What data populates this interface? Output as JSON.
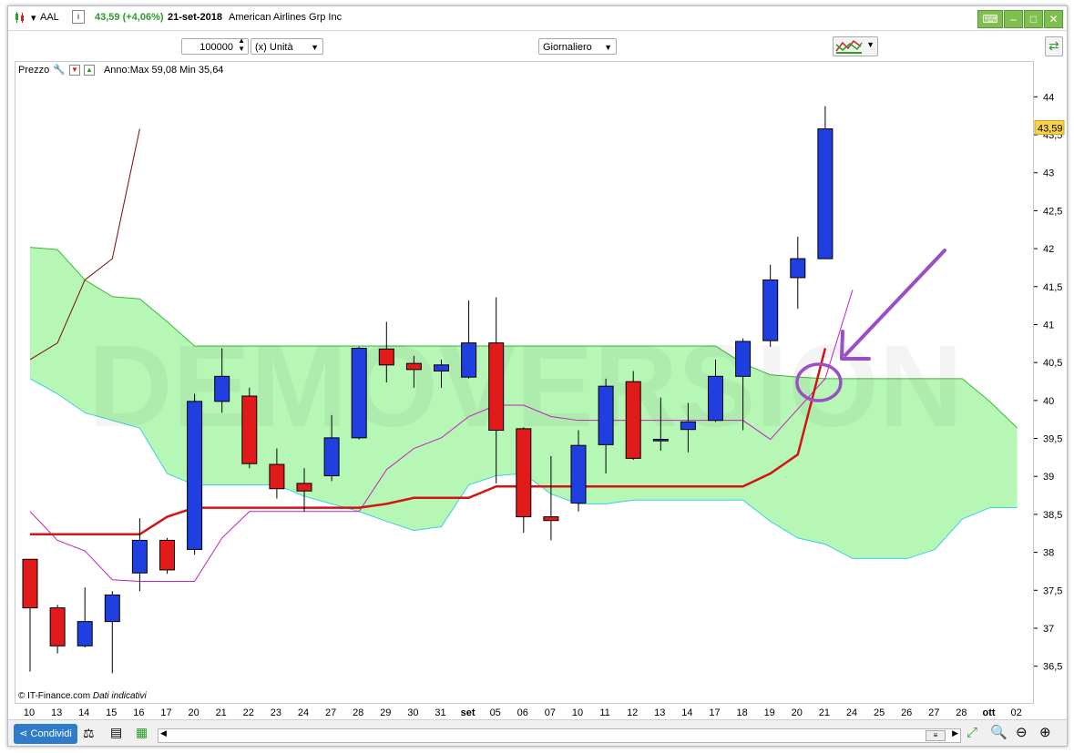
{
  "header": {
    "symbol": "AAL",
    "price_change": "43,59 (+4,06%)",
    "date": "21-set-2018",
    "company": "American Airlines Grp Inc"
  },
  "toolbar": {
    "quantity": "100000",
    "unit": "(x) Unità",
    "period": "Giornaliero"
  },
  "chart_panel": {
    "label": "Prezzo",
    "range_info": "Anno:Max 59,08 Min 35,64",
    "watermark": "DEMOVERSION",
    "copyright": "© IT-Finance.com",
    "disclaimer": "Dati indicativi",
    "last_price_label": "43,59"
  },
  "bottom": {
    "share_label": "Condividi"
  },
  "colors": {
    "bull": "#1f3fe0",
    "bear": "#e11a1a",
    "cloud": "#b6f7b6",
    "kijun": "#d21414",
    "tenkan": "#c020c0",
    "chikou": "#7a0a0a",
    "annotation": "#9a4fc4"
  },
  "chart_data": {
    "type": "candlestick",
    "y_range": [
      36.1,
      44.4
    ],
    "y_ticks": [
      "44",
      "43,5",
      "43",
      "42,5",
      "42",
      "41,5",
      "41",
      "40,5",
      "40",
      "39,5",
      "39",
      "38,5",
      "38",
      "37,5",
      "37",
      "36,5"
    ],
    "y_tick_values": [
      44,
      43.5,
      43,
      42.5,
      42,
      41.5,
      41,
      40.5,
      40,
      39.5,
      39,
      38.5,
      38,
      37.5,
      37,
      36.5
    ],
    "x_labels": [
      "10",
      "13",
      "14",
      "15",
      "16",
      "17",
      "20",
      "21",
      "22",
      "23",
      "24",
      "27",
      "28",
      "29",
      "30",
      "31",
      "set",
      "05",
      "06",
      "07",
      "10",
      "11",
      "12",
      "13",
      "14",
      "17",
      "18",
      "19",
      "20",
      "21",
      "24",
      "25",
      "26",
      "27",
      "28",
      "ott",
      "02"
    ],
    "bold_x_labels": [
      "set",
      "ott"
    ],
    "candles": [
      {
        "o": 37.92,
        "h": 37.92,
        "l": 36.44,
        "c": 37.28
      },
      {
        "o": 37.28,
        "h": 37.32,
        "l": 36.68,
        "c": 36.78
      },
      {
        "o": 36.78,
        "h": 37.55,
        "l": 36.76,
        "c": 37.1
      },
      {
        "o": 37.1,
        "h": 37.5,
        "l": 36.42,
        "c": 37.45
      },
      {
        "o": 37.74,
        "h": 38.46,
        "l": 37.5,
        "c": 38.17
      },
      {
        "o": 38.17,
        "h": 38.2,
        "l": 37.73,
        "c": 37.78
      },
      {
        "o": 38.05,
        "h": 40.1,
        "l": 37.98,
        "c": 40.0
      },
      {
        "o": 40.0,
        "h": 40.7,
        "l": 39.85,
        "c": 40.33
      },
      {
        "o": 40.07,
        "h": 40.18,
        "l": 39.12,
        "c": 39.18
      },
      {
        "o": 39.17,
        "h": 39.38,
        "l": 38.72,
        "c": 38.85
      },
      {
        "o": 38.92,
        "h": 39.12,
        "l": 38.55,
        "c": 38.82
      },
      {
        "o": 39.02,
        "h": 39.82,
        "l": 38.95,
        "c": 39.52
      },
      {
        "o": 39.52,
        "h": 40.72,
        "l": 39.5,
        "c": 40.7
      },
      {
        "o": 40.69,
        "h": 41.05,
        "l": 40.25,
        "c": 40.48
      },
      {
        "o": 40.5,
        "h": 40.6,
        "l": 40.18,
        "c": 40.42
      },
      {
        "o": 40.4,
        "h": 40.55,
        "l": 40.18,
        "c": 40.48
      },
      {
        "o": 40.32,
        "h": 41.33,
        "l": 40.3,
        "c": 40.77
      },
      {
        "o": 40.77,
        "h": 41.37,
        "l": 38.92,
        "c": 39.62
      },
      {
        "o": 39.64,
        "h": 39.66,
        "l": 38.27,
        "c": 38.48
      },
      {
        "o": 38.48,
        "h": 39.28,
        "l": 38.17,
        "c": 38.43
      },
      {
        "o": 38.66,
        "h": 39.62,
        "l": 38.55,
        "c": 39.42
      },
      {
        "o": 39.43,
        "h": 40.3,
        "l": 39.05,
        "c": 40.2
      },
      {
        "o": 40.26,
        "h": 40.4,
        "l": 39.23,
        "c": 39.25
      },
      {
        "o": 39.48,
        "h": 40.05,
        "l": 39.35,
        "c": 39.5
      },
      {
        "o": 39.63,
        "h": 39.98,
        "l": 39.33,
        "c": 39.73
      },
      {
        "o": 39.75,
        "h": 40.55,
        "l": 39.73,
        "c": 40.33
      },
      {
        "o": 40.33,
        "h": 40.83,
        "l": 39.62,
        "c": 40.79
      },
      {
        "o": 40.8,
        "h": 41.8,
        "l": 40.72,
        "c": 41.6
      },
      {
        "o": 41.63,
        "h": 42.17,
        "l": 41.22,
        "c": 41.88
      },
      {
        "o": 41.88,
        "h": 43.89,
        "l": 41.88,
        "c": 43.59
      }
    ],
    "kijun": [
      38.25,
      38.25,
      38.25,
      38.25,
      38.25,
      38.48,
      38.6,
      38.6,
      38.6,
      38.6,
      38.6,
      38.6,
      38.6,
      38.65,
      38.73,
      38.73,
      38.73,
      38.88,
      38.88,
      38.88,
      38.88,
      38.88,
      38.88,
      38.88,
      38.88,
      38.88,
      38.88,
      39.05,
      39.3,
      40.7
    ],
    "tenkan": [
      38.55,
      38.17,
      38.03,
      37.65,
      37.63,
      37.63,
      37.63,
      38.2,
      38.55,
      38.55,
      38.55,
      38.55,
      38.55,
      39.1,
      39.38,
      39.52,
      39.8,
      39.95,
      39.95,
      39.8,
      39.75,
      39.75,
      39.75,
      39.75,
      39.75,
      39.75,
      39.75,
      39.5,
      39.9,
      40.3,
      41.47
    ],
    "chikou": [
      40.55,
      40.77,
      41.6,
      41.88,
      43.59
    ],
    "cloud_upper": [
      42.03,
      42.0,
      41.6,
      41.38,
      41.35,
      41.05,
      40.73,
      40.73,
      40.73,
      40.73,
      40.73,
      40.73,
      40.73,
      40.73,
      40.73,
      40.73,
      40.73,
      40.73,
      40.73,
      40.73,
      40.73,
      40.73,
      40.73,
      40.73,
      40.73,
      40.73,
      40.5,
      40.35,
      40.32,
      40.3,
      40.3,
      40.3,
      40.3,
      40.3,
      40.3,
      40.0,
      39.65
    ],
    "cloud_lower": [
      40.3,
      40.1,
      39.85,
      39.75,
      39.65,
      39.05,
      38.9,
      38.9,
      38.9,
      38.9,
      38.75,
      38.65,
      38.55,
      38.42,
      38.3,
      38.35,
      38.9,
      39.02,
      39.05,
      38.78,
      38.65,
      38.65,
      38.7,
      38.7,
      38.7,
      38.7,
      38.7,
      38.42,
      38.2,
      38.12,
      37.93,
      37.93,
      37.93,
      38.05,
      38.45,
      38.6,
      38.6
    ]
  }
}
